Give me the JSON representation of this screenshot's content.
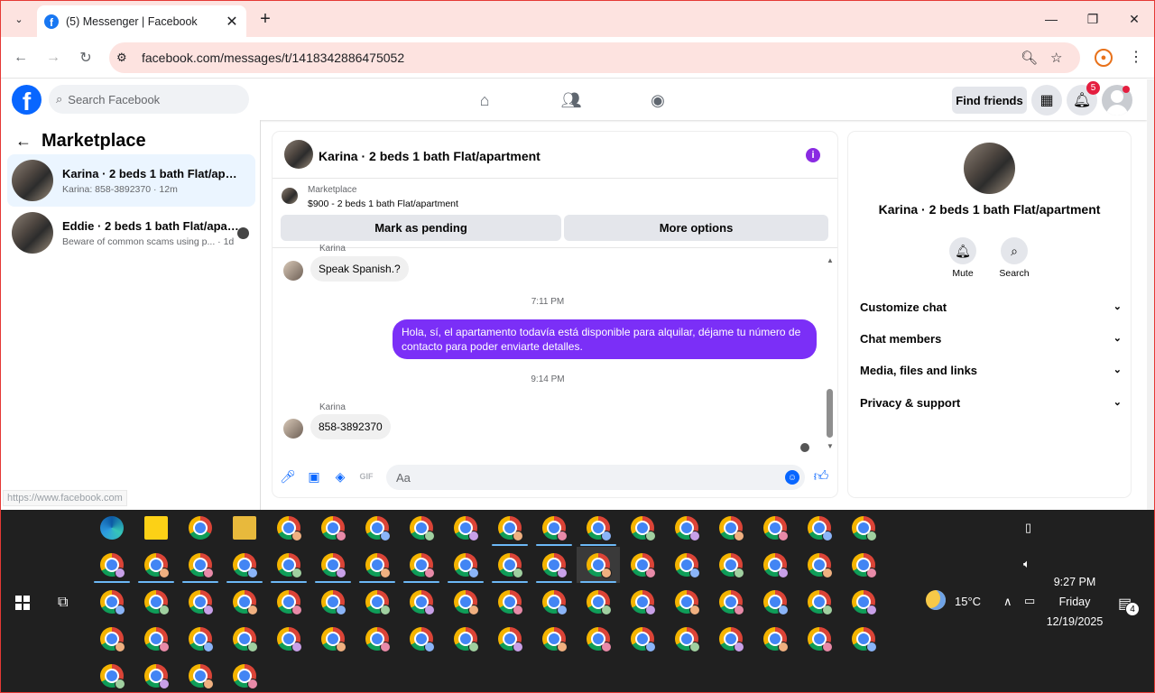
{
  "browser": {
    "tab_title": "(5) Messenger | Facebook",
    "url": "facebook.com/messages/t/1418342886475052",
    "status_url": "https://www.facebook.com"
  },
  "fb": {
    "logo_letter": "f",
    "search_placeholder": "Search Facebook",
    "find_friends": "Find friends",
    "notif_count": "5"
  },
  "left": {
    "title": "Marketplace",
    "threads": [
      {
        "name": "Karina · 2 beds 1 bath Flat/apartm...",
        "sub": "Karina: 858-3892370 · 12m"
      },
      {
        "name": "Eddie · 2 beds 1 bath Flat/apart...",
        "sub": "Beware of common scams using p... · 1d"
      }
    ]
  },
  "chat": {
    "title": "Karina · 2 beds 1 bath Flat/apartment",
    "marketplace_label": "Marketplace",
    "listing": "$900 - 2 beds 1 bath Flat/apartment",
    "btn_pending": "Mark as pending",
    "btn_more": "More options",
    "sender_top": "Karina",
    "msg1": "Speak Spanish.?",
    "time1": "7:11 PM",
    "msg_out": "Hola, sí, el apartamento todavía está disponible para alquilar, déjame tu número de contacto para poder enviarte detalles.",
    "time2": "9:14 PM",
    "sender2": "Karina",
    "msg2": "858-3892370",
    "composer_placeholder": "Aa"
  },
  "right": {
    "name": "Karina · 2 beds 1 bath Flat/apartment",
    "mute": "Mute",
    "search": "Search",
    "sections": [
      "Customize chat",
      "Chat members",
      "Media, files and links",
      "Privacy & support"
    ]
  },
  "taskbar": {
    "temperature": "15°C",
    "time": "9:27 PM",
    "day": "Friday",
    "date": "12/19/2025",
    "notifications": "4"
  },
  "colors": {
    "accent": "#0866ff",
    "bubble_out": "#7b2ff7",
    "browser_frame": "#fde3e0"
  }
}
